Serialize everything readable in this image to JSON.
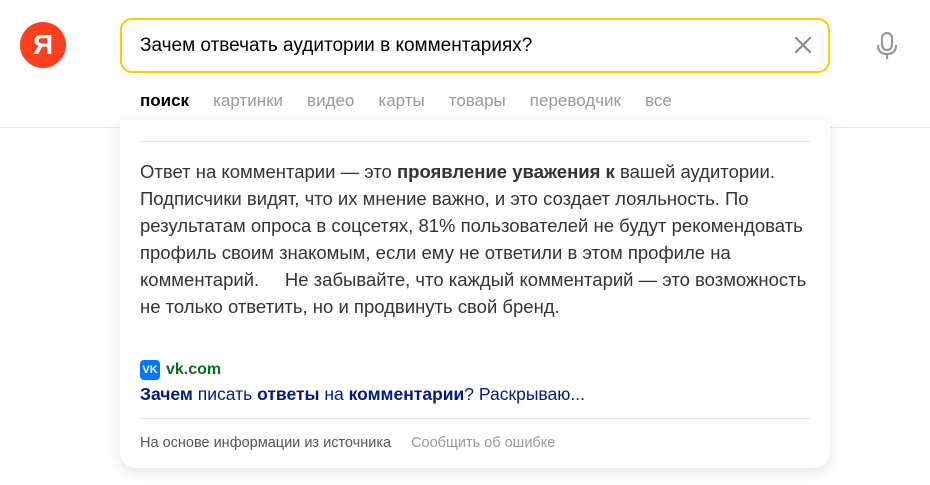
{
  "logo": {
    "letter": "Я",
    "color": "#fc3f1d"
  },
  "search": {
    "value": "Зачем отвечать аудитории в комментариях?",
    "clear_icon": "close-icon",
    "mic_icon": "microphone-icon",
    "border_color": "#ffcc00"
  },
  "tabs": [
    {
      "label": "поиск",
      "active": true
    },
    {
      "label": "картинки"
    },
    {
      "label": "видео"
    },
    {
      "label": "карты"
    },
    {
      "label": "товары"
    },
    {
      "label": "переводчик"
    },
    {
      "label": "все"
    }
  ],
  "answer": {
    "p1": "Ответ на комментарии — это ",
    "bold1": "проявление уважения к",
    "p2": " вашей аудитории. Подписчики видят, что их мнение важно, и это создает лояльность. По результатам опроса в соцсетях, 81% пользователей не будут рекомендовать профиль своим знакомым, если ему не ответили в этом профиле на комментарий.     Не забывайте, что каждый комментарий — это возможность не только ответить, но и продвинуть свой бренд."
  },
  "source": {
    "icon": "vk-icon",
    "icon_text": "VK",
    "domain": "vk.com",
    "domain_color": "#0a6b1e",
    "title_parts": {
      "b1": "Зачем",
      "t1": " писать ",
      "b2": "ответы",
      "t2": " на ",
      "b3": "комментарии",
      "t3": "? Раскрываю..."
    }
  },
  "footer": {
    "note": "На основе информации из источника",
    "report": "Сообщить об ошибке"
  }
}
